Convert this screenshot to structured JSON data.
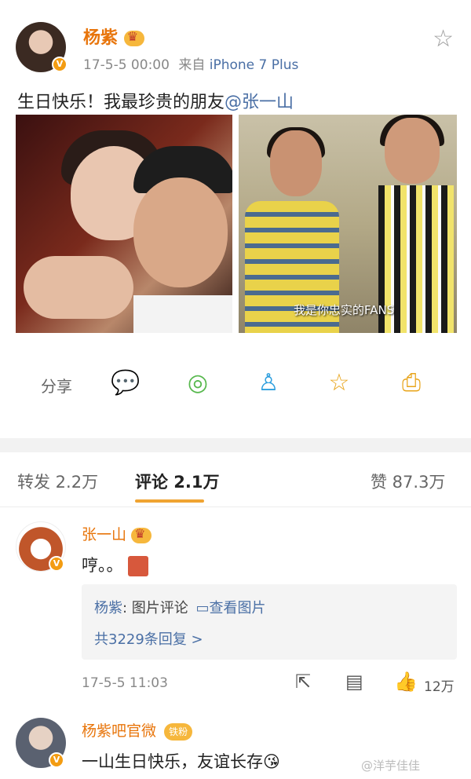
{
  "post": {
    "username": "杨紫",
    "timestamp": "17-5-5 00:00",
    "source_prefix": "来自",
    "source_device": "iPhone 7 Plus",
    "text": "生日快乐！我最珍贵的朋友",
    "mention": "@张一山",
    "photo2_caption": "我是你忠实的FANS",
    "share_label": "分享",
    "share_icons": [
      "wechat-icon",
      "moments-icon",
      "qq-icon",
      "favorite-icon",
      "save-image-icon"
    ]
  },
  "tabs": {
    "repost": "转发 2.2万",
    "comment": "评论 2.1万",
    "like": "赞 87.3万"
  },
  "comments": [
    {
      "username": "张一山",
      "text": "哼。。",
      "reply_author": "杨紫",
      "reply_text": ": 图片评论",
      "reply_link": "查看图片",
      "reply_count": "共3229条回复 >",
      "time": "17-5-5 11:03",
      "likes": "12万"
    },
    {
      "username": "杨紫吧官微",
      "badge": "铁粉",
      "text": "一山生日快乐，友谊长存"
    }
  ],
  "watermark": "@洋芋佳佳",
  "colors": {
    "username": "#e8750b",
    "link": "#4a6fa5",
    "accent": "#f0a432"
  }
}
